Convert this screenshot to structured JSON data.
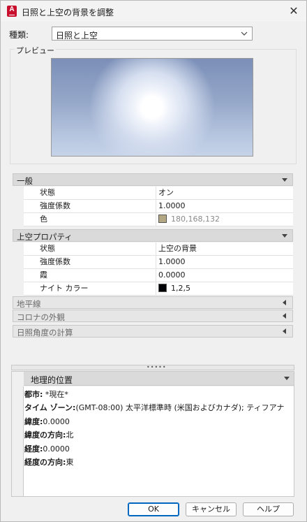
{
  "window": {
    "title": "日照と上空の背景を調整",
    "app_icon_letter": "A",
    "close_glyph": "✕"
  },
  "type_field": {
    "label": "種類:",
    "value": "日照と上空"
  },
  "preview": {
    "label": "プレビュー"
  },
  "sections": {
    "general": {
      "title": "一般",
      "rows": [
        {
          "key": "状態",
          "value": "オン"
        },
        {
          "key": "強度係数",
          "value": "1.0000"
        },
        {
          "key": "色",
          "value": "180,168,132",
          "swatch": "#b4a884"
        }
      ]
    },
    "sky_props": {
      "title": "上空プロパティ",
      "rows": [
        {
          "key": "状態",
          "value": "上空の背景"
        },
        {
          "key": "強度係数",
          "value": "1.0000"
        },
        {
          "key": "霞",
          "value": "0.0000"
        },
        {
          "key": "ナイト カラー",
          "value": "1,2,5",
          "swatch": "#010205"
        }
      ]
    },
    "horizon": {
      "title": "地平線"
    },
    "corona": {
      "title": "コロナの外観"
    },
    "sun_angle": {
      "title": "日照角度の計算"
    }
  },
  "geo": {
    "title": "地理的位置",
    "lines": [
      {
        "label": "都市:",
        "value": " *現在*"
      },
      {
        "label": "タイム ゾーン:",
        "value": "(GMT-08:00) 太平洋標準時 (米国およびカナダ); ティフアナ"
      },
      {
        "label": "緯度:",
        "value": "0.0000"
      },
      {
        "label": "緯度の方向:",
        "value": "北"
      },
      {
        "label": "経度:",
        "value": "0.0000"
      },
      {
        "label": "経度の方向:",
        "value": "東"
      }
    ]
  },
  "buttons": {
    "ok": "OK",
    "cancel": "キャンセル",
    "help": "ヘルプ"
  },
  "splitter_grip": "•••••",
  "colors": {
    "accent": "#0067c0",
    "brand": "#c8102e",
    "section_bg": "#dadada"
  }
}
